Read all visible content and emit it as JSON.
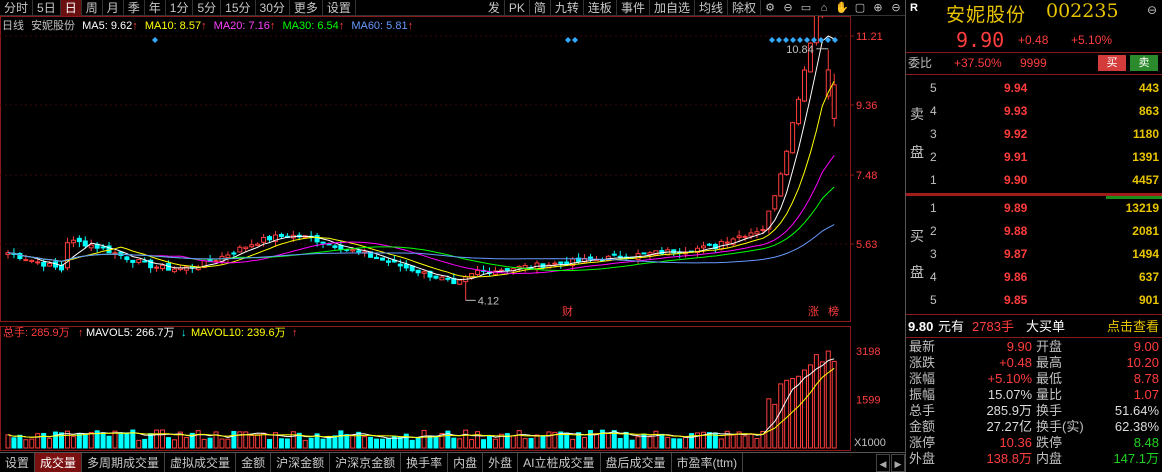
{
  "toolbar": {
    "items": [
      "分时",
      "5日",
      "日",
      "周",
      "月",
      "季",
      "年",
      "1分",
      "5分",
      "15分",
      "30分",
      "更多",
      "设置"
    ],
    "active": "日",
    "right_items": [
      "发",
      "PK",
      "简",
      "九转",
      "连板",
      "事件",
      "加自选",
      "均线",
      "除权"
    ],
    "icons": [
      "gear-icon",
      "zoom-out-icon",
      "print-icon",
      "share-icon",
      "hand-icon",
      "panel-icon",
      "plus-icon",
      "minus-icon"
    ]
  },
  "infoline": {
    "period": "日线",
    "stock": "安妮股份",
    "ma5": "MA5: 9.62",
    "ma10": "MA10: 8.57",
    "ma20": "MA20: 7.16",
    "ma30": "MA30: 6.54",
    "ma60": "MA60: 5.81",
    "arrow": "↑"
  },
  "price_axis": {
    "labels": [
      "11.21",
      "9.36",
      "7.48",
      "5.63"
    ]
  },
  "annotations": {
    "high": "10.84",
    "low": "4.12",
    "cai": "财",
    "zhang": "涨",
    "bang": "榜"
  },
  "volume": {
    "total": "总手: 285.9万",
    "mavol5": "MAVOL5: 266.7万",
    "mavol10": "MAVOL10: 239.6万",
    "up": "↑",
    "down": "↓",
    "axis": [
      "3198",
      "1599"
    ],
    "unit": "X1000"
  },
  "bottom_tabs": [
    "设置",
    "成交量",
    "多周期成交量",
    "虚拟成交量",
    "金额",
    "沪深金额",
    "沪深京金额",
    "换手率",
    "内盘",
    "外盘",
    "AI立桩成交量",
    "盘后成交量",
    "市盈率(ttm)"
  ],
  "bottom_active": "成交量",
  "quote": {
    "flag": "R",
    "name": "安妮股份",
    "code": "002235",
    "price": "9.90",
    "change": "+0.48",
    "pct": "+5.10%",
    "weibi_label": "委比",
    "weibi": "+37.50%",
    "weicha": "9999",
    "buy_btn": "买",
    "sell_btn": "卖",
    "sell_label": "卖盘",
    "buy_label": "买盘",
    "asks": [
      {
        "lvl": "5",
        "price": "9.94",
        "vol": "443"
      },
      {
        "lvl": "4",
        "price": "9.93",
        "vol": "863"
      },
      {
        "lvl": "3",
        "price": "9.92",
        "vol": "1180"
      },
      {
        "lvl": "2",
        "price": "9.91",
        "vol": "1391"
      },
      {
        "lvl": "1",
        "price": "9.90",
        "vol": "4457"
      }
    ],
    "bids": [
      {
        "lvl": "1",
        "price": "9.89",
        "vol": "13219"
      },
      {
        "lvl": "2",
        "price": "9.88",
        "vol": "2081"
      },
      {
        "lvl": "3",
        "price": "9.87",
        "vol": "1494"
      },
      {
        "lvl": "4",
        "price": "9.86",
        "vol": "637"
      },
      {
        "lvl": "5",
        "price": "9.85",
        "vol": "901"
      }
    ],
    "big_order": {
      "price": "9.80",
      "text1": "元有",
      "qty": "2783手",
      "text2": "大买单",
      "link": "点击查看"
    },
    "stats": [
      {
        "l1": "最新",
        "v1": "9.90",
        "c1": "red",
        "l2": "开盘",
        "v2": "9.00",
        "c2": "red"
      },
      {
        "l1": "涨跌",
        "v1": "+0.48",
        "c1": "red",
        "l2": "最高",
        "v2": "10.20",
        "c2": "red"
      },
      {
        "l1": "涨幅",
        "v1": "+5.10%",
        "c1": "red",
        "l2": "最低",
        "v2": "8.78",
        "c2": "red"
      },
      {
        "l1": "振幅",
        "v1": "15.07%",
        "c1": "wht",
        "l2": "量比",
        "v2": "1.07",
        "c2": "red"
      },
      {
        "l1": "总手",
        "v1": "285.9万",
        "c1": "wht",
        "l2": "换手",
        "v2": "51.64%",
        "c2": "wht"
      },
      {
        "l1": "金额",
        "v1": "27.27亿",
        "c1": "wht",
        "l2": "换手(实)",
        "v2": "62.38%",
        "c2": "wht"
      },
      {
        "l1": "涨停",
        "v1": "10.36",
        "c1": "red",
        "l2": "跌停",
        "v2": "8.48",
        "c2": "grn"
      },
      {
        "l1": "外盘",
        "v1": "138.8万",
        "c1": "red",
        "l2": "内盘",
        "v2": "147.1万",
        "c2": "grn"
      }
    ]
  },
  "colors": {
    "up": "#ff3d3d",
    "down": "#00ffff",
    "ma5": "#ffffff",
    "ma10": "#ffff00",
    "ma20": "#ff00ff",
    "ma30": "#00ff00",
    "ma60": "#6699ff"
  }
}
